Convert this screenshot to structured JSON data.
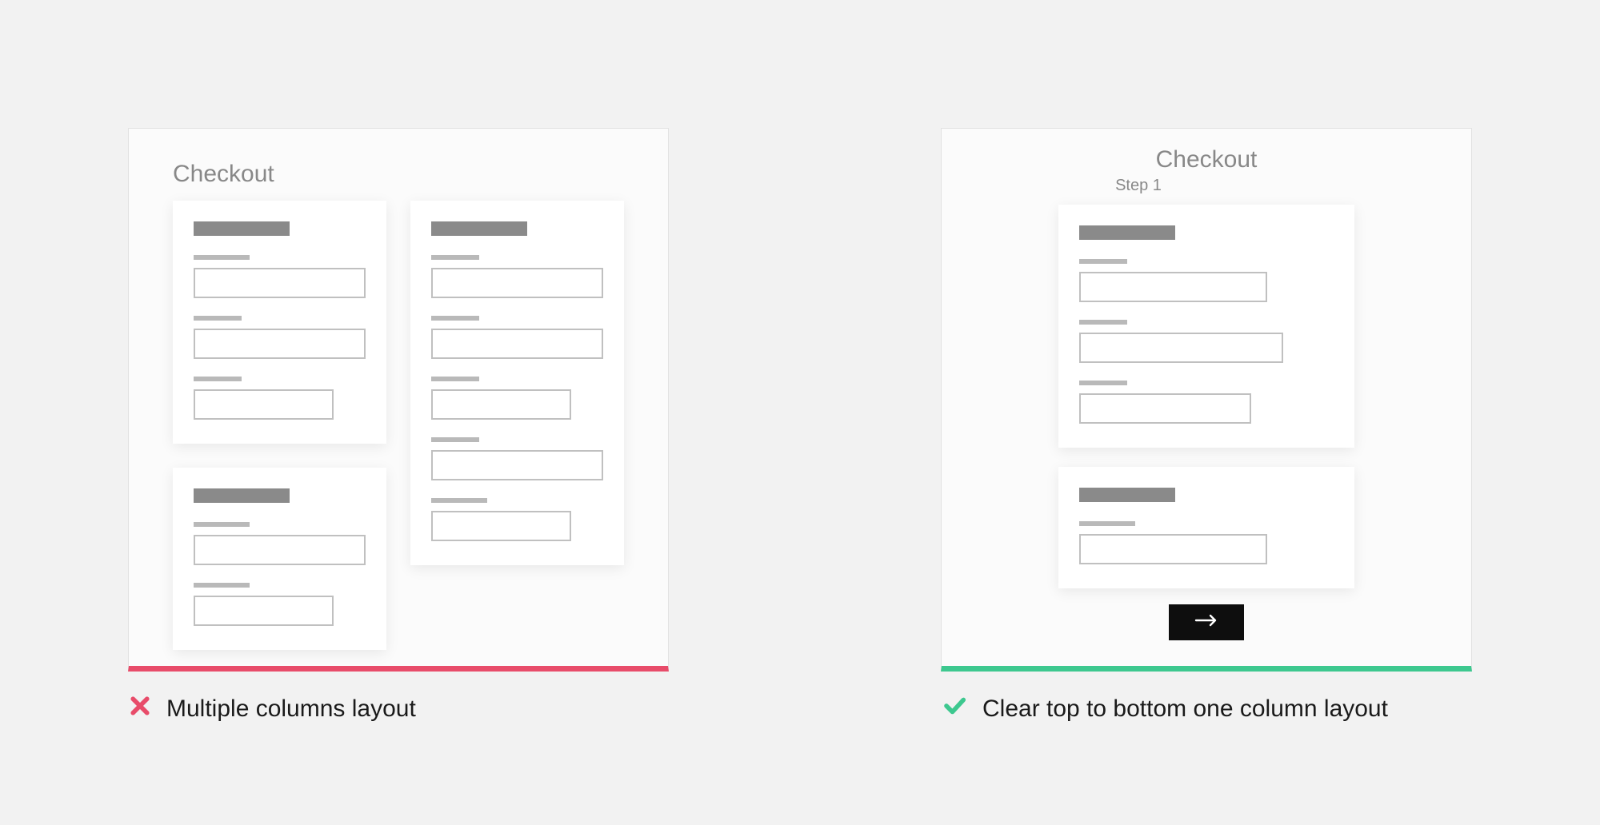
{
  "bad": {
    "panel_title": "Checkout",
    "caption": "Multiple columns layout"
  },
  "good": {
    "panel_title": "Checkout",
    "step_label": "Step 1",
    "caption": "Clear top to bottom one column layout"
  },
  "colors": {
    "bad_accent": "#e84c6a",
    "good_accent": "#3dc88f"
  }
}
